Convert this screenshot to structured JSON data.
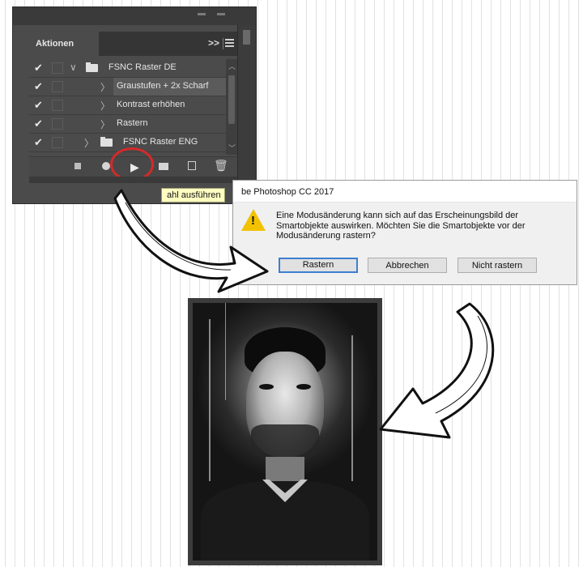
{
  "actions_panel": {
    "tab_label": "Aktionen",
    "tab_more": ">>",
    "rows": [
      {
        "label": "FSNC Raster DE",
        "checked": true,
        "expanded": true,
        "folder": true
      },
      {
        "label": "Graustufen + 2x Scharf",
        "checked": true,
        "expanded": false,
        "folder": false,
        "selected": true
      },
      {
        "label": "Kontrast erhöhen",
        "checked": true,
        "expanded": false,
        "folder": false
      },
      {
        "label": "Rastern",
        "checked": true,
        "expanded": false,
        "folder": false
      },
      {
        "label": "FSNC Raster ENG",
        "checked": true,
        "expanded": false,
        "folder": true
      }
    ],
    "toolbar_icons": [
      "stop-icon",
      "record-icon",
      "play-icon",
      "folder-icon",
      "new-action-icon",
      "trash-icon"
    ],
    "tooltip": "ahl ausführen",
    "highlight_color": "#d42a2a"
  },
  "dialog": {
    "title": "be Photoshop CC 2017",
    "message": "Eine Modusänderung kann sich auf das Erscheinungsbild der Smartobjekte auswirken. Möchten Sie die Smartobjekte vor der Modusänderung rastern?",
    "buttons": {
      "rastern": "Rastern",
      "abbrechen": "Abbrechen",
      "nicht_rastern": "Nicht rastern"
    },
    "icon": "warning-icon"
  },
  "portrait": {
    "description_icon": "portrait-image"
  }
}
